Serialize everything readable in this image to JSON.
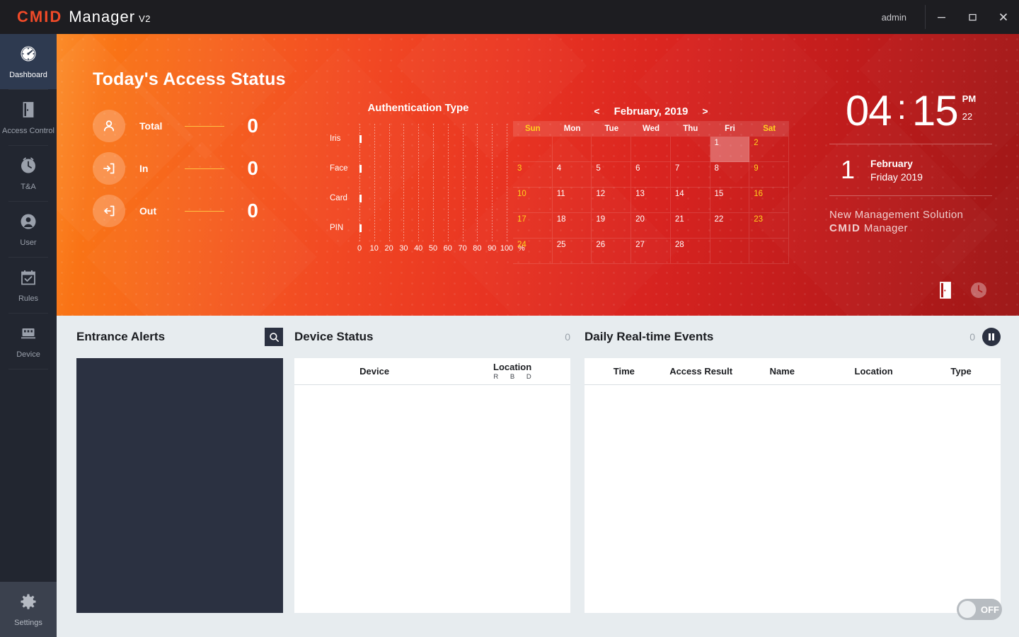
{
  "titlebar": {
    "logo_cmid": "CMID",
    "logo_manager": "Manager",
    "logo_version": "V2",
    "user": "admin",
    "minimize": "minimize-icon",
    "maximize": "maximize-icon",
    "close": "close-icon"
  },
  "sidebar": {
    "items": [
      {
        "label": "Dashboard",
        "icon": "dashboard-icon",
        "active": true
      },
      {
        "label": "Access Control",
        "icon": "door-icon",
        "active": false
      },
      {
        "label": "T&A",
        "icon": "clock-icon",
        "active": false
      },
      {
        "label": "User",
        "icon": "user-icon",
        "active": false
      },
      {
        "label": "Rules",
        "icon": "calendar-check-icon",
        "active": false
      },
      {
        "label": "Device",
        "icon": "device-icon",
        "active": false
      }
    ],
    "settings": {
      "label": "Settings",
      "icon": "gear-icon"
    }
  },
  "hero": {
    "title": "Today's Access Status",
    "stats": [
      {
        "label": "Total",
        "value": "0",
        "icon": "person-icon"
      },
      {
        "label": "In",
        "value": "0",
        "icon": "arrow-in-icon"
      },
      {
        "label": "Out",
        "value": "0",
        "icon": "arrow-out-icon"
      }
    ],
    "accent_yellow": "#ffd21e",
    "icons": [
      {
        "name": "door-icon",
        "active": true
      },
      {
        "name": "clock-icon",
        "active": false
      }
    ]
  },
  "chart_data": {
    "type": "bar",
    "title": "Authentication Type",
    "categories": [
      "Iris",
      "Face",
      "Card",
      "PIN"
    ],
    "values": [
      0,
      0,
      0,
      0
    ],
    "xlabel": "%",
    "ylabel": "",
    "xlim": [
      0,
      100
    ],
    "xticks": [
      0,
      10,
      20,
      30,
      40,
      50,
      60,
      70,
      80,
      90,
      100
    ],
    "xtick_labels": [
      "0",
      "10",
      "20",
      "30",
      "40",
      "50",
      "60",
      "70",
      "80",
      "90",
      "100"
    ],
    "unit_label": "%",
    "grid": true,
    "orientation": "horizontal",
    "legend": false,
    "bar_color": "#ffffff"
  },
  "calendar": {
    "prev": "<",
    "next": ">",
    "month_label": "February, 2019",
    "dow": [
      "Sun",
      "Mon",
      "Tue",
      "Wed",
      "Thu",
      "Fri",
      "Sat"
    ],
    "weekend_cols": [
      0,
      6
    ],
    "lead_blanks": 5,
    "days": [
      1,
      2,
      3,
      4,
      5,
      6,
      7,
      8,
      9,
      10,
      11,
      12,
      13,
      14,
      15,
      16,
      17,
      18,
      19,
      20,
      21,
      22,
      23,
      24,
      25,
      26,
      27,
      28
    ],
    "today": 1
  },
  "clock": {
    "hour": "04",
    "colon": ":",
    "minute": "15",
    "ampm": "PM",
    "seconds": "22",
    "day": "1",
    "month": "February",
    "weekday_year": "Friday 2019",
    "tagline_top": "New Management Solution",
    "tagline_brand": "CMID",
    "tagline_rest": " Manager"
  },
  "entrance_alerts": {
    "title": "Entrance Alerts",
    "search_icon": "search-icon"
  },
  "device_status": {
    "title": "Device Status",
    "count": "0",
    "columns": [
      "Device",
      "Location"
    ],
    "location_sub": "R B D",
    "rows": []
  },
  "events": {
    "title": "Daily Real-time Events",
    "count": "0",
    "pause_icon": "pause-icon",
    "columns": [
      "Time",
      "Access Result",
      "Name",
      "Location",
      "Type"
    ],
    "rows": []
  },
  "footer_toggle": {
    "label": "OFF",
    "state": "off"
  }
}
